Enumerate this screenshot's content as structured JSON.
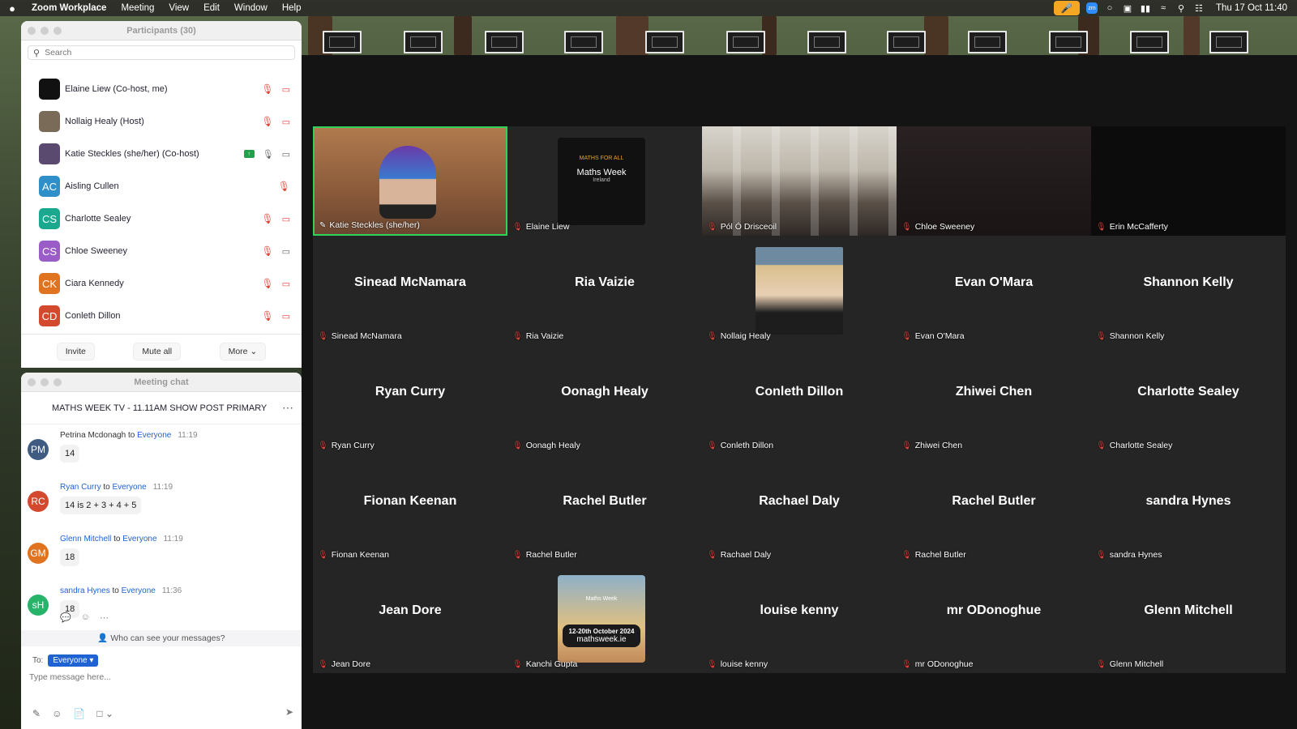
{
  "menubar": {
    "app": "Zoom Workplace",
    "items": [
      "Meeting",
      "View",
      "Edit",
      "Window",
      "Help"
    ],
    "clock": "Thu 17 Oct  11:40"
  },
  "participants_panel": {
    "title": "Participants (30)",
    "search_placeholder": "Search",
    "list": [
      {
        "name": "Elaine Liew (Co-host, me)",
        "initials": "",
        "color": "#111111",
        "mic": "off",
        "cam": "off"
      },
      {
        "name": "Nollaig Healy (Host)",
        "initials": "",
        "color": "#7a6a58",
        "mic": "off",
        "cam": "off"
      },
      {
        "name": "Katie Steckles (she/her) (Co-host)",
        "initials": "",
        "color": "#5a4a70",
        "mic": "on",
        "cam": "on",
        "sharing": true
      },
      {
        "name": "Aisling Cullen",
        "initials": "AC",
        "color": "#2e8fc9",
        "mic": "off",
        "cam": "none"
      },
      {
        "name": "Charlotte Sealey",
        "initials": "CS",
        "color": "#1aa98f",
        "mic": "off",
        "cam": "off"
      },
      {
        "name": "Chloe Sweeney",
        "initials": "CS",
        "color": "#9a5cc7",
        "mic": "off",
        "cam": "on"
      },
      {
        "name": "Ciara Kennedy",
        "initials": "CK",
        "color": "#e0731f",
        "mic": "off",
        "cam": "off"
      },
      {
        "name": "Conleth Dillon",
        "initials": "CD",
        "color": "#d2492e",
        "mic": "off",
        "cam": "off"
      }
    ],
    "buttons": {
      "invite": "Invite",
      "mute_all": "Mute all",
      "more": "More"
    }
  },
  "chat_panel": {
    "title": "Meeting chat",
    "channel": "MATHS WEEK TV - 11.11AM SHOW POST PRIMARY",
    "messages": [
      {
        "sender": "Petrina Mcdonagh",
        "to": "Everyone",
        "time": "11:19",
        "text": "14",
        "initials": "PM",
        "color": "#3f5b82",
        "sender_blue": false
      },
      {
        "sender": "Ryan Curry",
        "to": "Everyone",
        "time": "11:19",
        "text": "14 is 2 + 3 + 4 + 5",
        "initials": "RC",
        "color": "#d2492e",
        "sender_blue": true
      },
      {
        "sender": "Glenn Mitchell",
        "to": "Everyone",
        "time": "11:19",
        "text": "18",
        "initials": "GM",
        "color": "#e0731f",
        "sender_blue": true
      },
      {
        "sender": "sandra Hynes",
        "to": "Everyone",
        "time": "11:36",
        "text": "18",
        "initials": "sH",
        "color": "#27b36a",
        "sender_blue": true
      }
    ],
    "connector": "to",
    "who_can_see": "Who can see your messages?",
    "to_label": "To:",
    "to_value": "Everyone",
    "input_placeholder": "Type message here..."
  },
  "grid": {
    "tiles": [
      {
        "label": "Katie Steckles (she/her)",
        "center": "",
        "kind": "video-katie",
        "active": true,
        "pinned": true
      },
      {
        "label": "Elaine Liew",
        "center": "",
        "kind": "logo"
      },
      {
        "label": "Pól Ó Drisceoil",
        "center": "",
        "kind": "classroom"
      },
      {
        "label": "Chloe Sweeney",
        "center": "",
        "kind": "dark"
      },
      {
        "label": "Erin McCafferty",
        "center": "",
        "kind": "black"
      },
      {
        "label": "Sinead McNamara",
        "center": "Sinead McNamara",
        "kind": "name"
      },
      {
        "label": "Ria Vaizie",
        "center": "Ria Vaizie",
        "kind": "name"
      },
      {
        "label": "Nollaig Healy",
        "center": "",
        "kind": "portrait"
      },
      {
        "label": "Evan O'Mara",
        "center": "Evan O'Mara",
        "kind": "name"
      },
      {
        "label": "Shannon Kelly",
        "center": "Shannon Kelly",
        "kind": "name"
      },
      {
        "label": "Ryan Curry",
        "center": "Ryan Curry",
        "kind": "name"
      },
      {
        "label": "Oonagh Healy",
        "center": "Oonagh Healy",
        "kind": "name"
      },
      {
        "label": "Conleth Dillon",
        "center": "Conleth Dillon",
        "kind": "name"
      },
      {
        "label": "Zhiwei Chen",
        "center": "Zhiwei Chen",
        "kind": "name"
      },
      {
        "label": "Charlotte Sealey",
        "center": "Charlotte Sealey",
        "kind": "name"
      },
      {
        "label": "Fionan Keenan",
        "center": "Fionan Keenan",
        "kind": "name"
      },
      {
        "label": "Rachel Butler",
        "center": "Rachel Butler",
        "kind": "name"
      },
      {
        "label": "Rachael Daly",
        "center": "Rachael Daly",
        "kind": "name"
      },
      {
        "label": "Rachel Butler",
        "center": "Rachel Butler",
        "kind": "name"
      },
      {
        "label": "sandra Hynes",
        "center": "sandra Hynes",
        "kind": "name"
      },
      {
        "label": "Jean Dore",
        "center": "Jean Dore",
        "kind": "name"
      },
      {
        "label": "Kanchi Gupta",
        "center": "",
        "kind": "poster"
      },
      {
        "label": "louise kenny",
        "center": "louise kenny",
        "kind": "name"
      },
      {
        "label": "mr ODonoghue",
        "center": "mr ODonoghue",
        "kind": "name"
      },
      {
        "label": "Glenn Mitchell",
        "center": "Glenn Mitchell",
        "kind": "name"
      }
    ],
    "logo_text": {
      "line1": "Maths Week",
      "line2": "Ireland",
      "arc": "MATHS FOR ALL"
    },
    "poster_text": {
      "dates": "12-20th October 2024",
      "site": "mathsweek.ie",
      "brand": "Maths Week"
    }
  },
  "colors": {
    "active_border": "#2fd35a",
    "mic_off": "#e0473a",
    "link_blue": "#1f62d3",
    "tile_bg": "#252525"
  }
}
